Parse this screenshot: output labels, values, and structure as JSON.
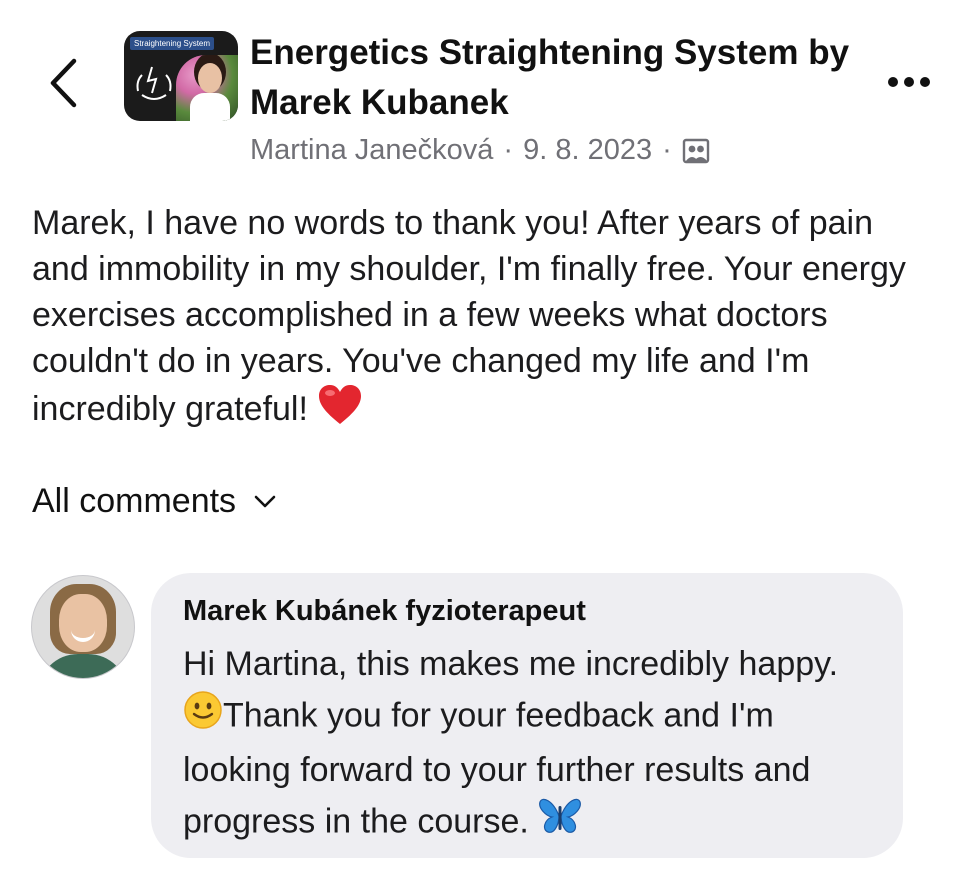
{
  "header": {
    "back_icon": "chevron-left-icon",
    "group_thumbnail_label": "Straightening System",
    "group_title": "Energetics Straightening System by Marek Kubanek",
    "author": "Martina Janečková",
    "separator": "·",
    "date": "9. 8. 2023",
    "audience_icon": "group-members-icon",
    "more_icon": "more-horizontal-icon"
  },
  "post": {
    "text": "Marek, I have no words to thank you! After years of pain and immobility in my shoulder, I'm finally free. Your energy exercises accomplished in a few weeks what doctors couldn't do in years. You've changed my life and I'm incredibly grateful!",
    "emoji": "❤️"
  },
  "comments_filter": {
    "label": "All comments",
    "icon": "chevron-down-icon"
  },
  "comments": [
    {
      "author": "Marek Kubánek fyzioterapeut",
      "text_part1": "Hi Martina, this makes me incredibly happy.",
      "emoji1": "🙂",
      "text_part2": "Thank you for your feedback and I'm looking forward to your further results and progress in the course.",
      "emoji2": "🦋"
    }
  ],
  "colors": {
    "bubble": "#eeeef2",
    "meta_text": "#707076",
    "heart": "#e3262f",
    "butterfly": "#2f8fe0"
  }
}
